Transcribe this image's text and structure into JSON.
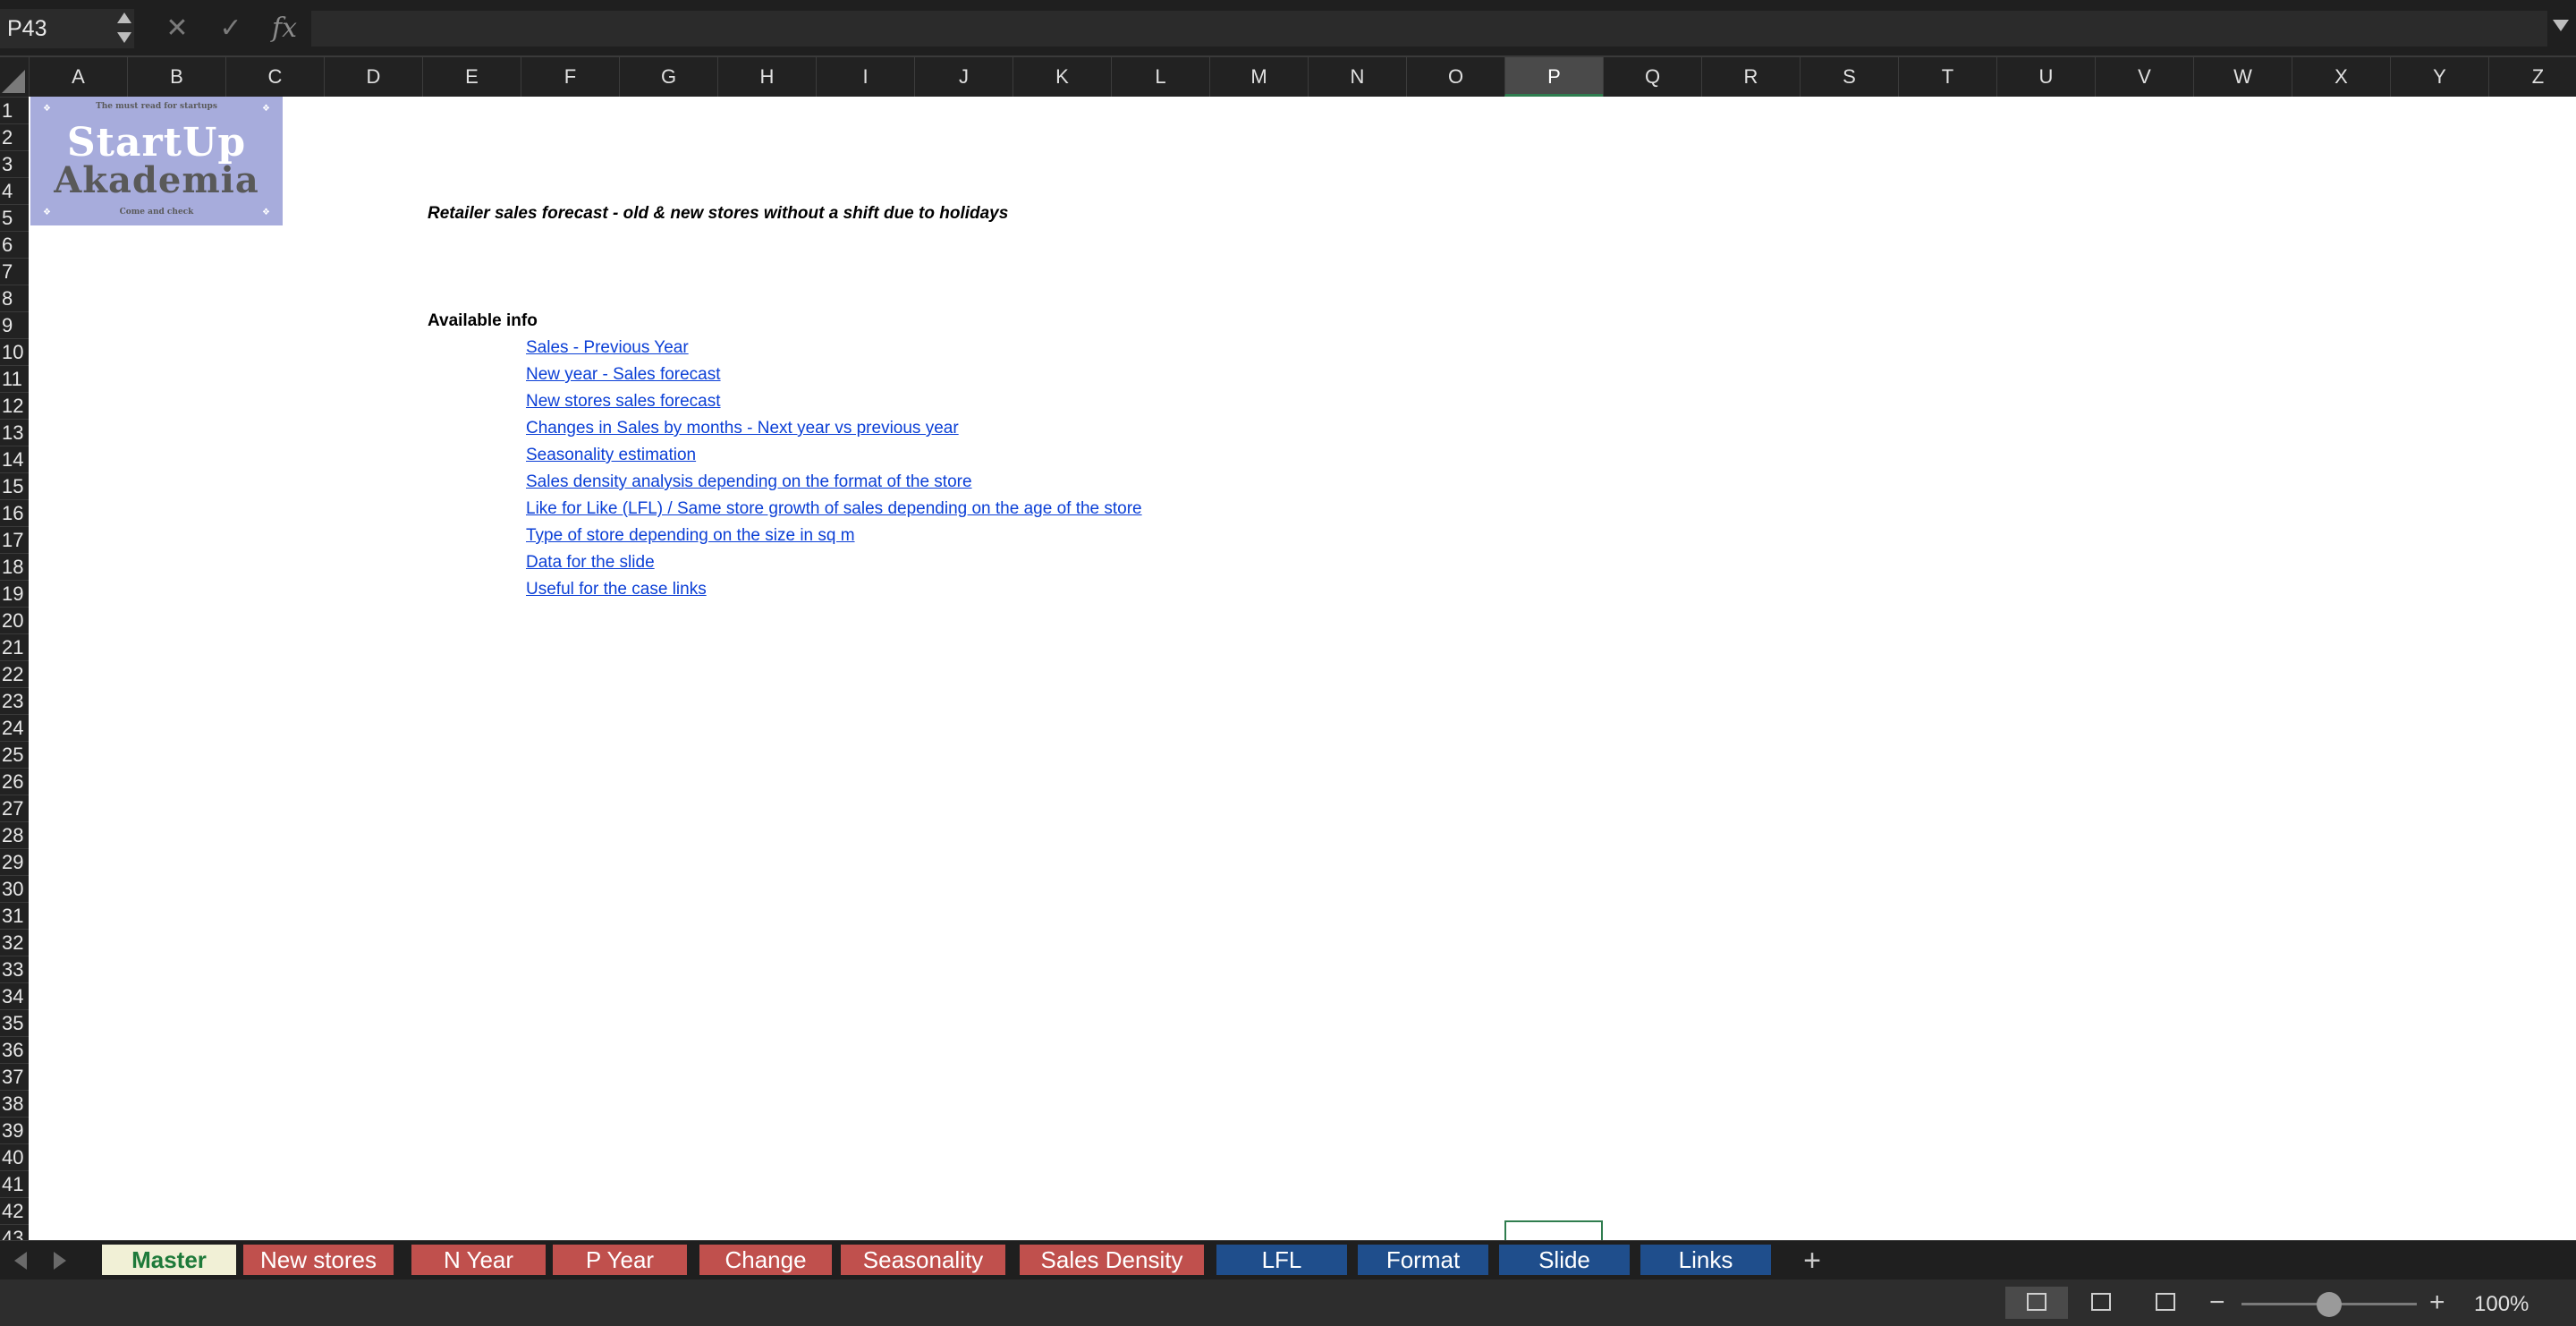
{
  "formula_bar": {
    "name_box": "P43",
    "cancel_icon": "close-icon",
    "confirm_icon": "check-icon",
    "fx_label": "fx",
    "formula_value": ""
  },
  "columns": [
    "A",
    "B",
    "C",
    "D",
    "E",
    "F",
    "G",
    "H",
    "I",
    "J",
    "K",
    "L",
    "M",
    "N",
    "O",
    "P",
    "Q",
    "R",
    "S",
    "T",
    "U",
    "V",
    "W",
    "X",
    "Y",
    "Z"
  ],
  "active_column": "P",
  "rows": [
    "1",
    "2",
    "3",
    "4",
    "5",
    "6",
    "7",
    "8",
    "9",
    "10",
    "11",
    "12",
    "13",
    "14",
    "15",
    "16",
    "17",
    "18",
    "19",
    "20",
    "21",
    "22",
    "23",
    "24",
    "25",
    "26",
    "27",
    "28",
    "29",
    "30",
    "31",
    "32",
    "33",
    "34",
    "35",
    "36",
    "37",
    "38",
    "39",
    "40",
    "41",
    "42",
    "43"
  ],
  "logo": {
    "tagline": "The must read for startups",
    "brand_line1": "StartUp",
    "brand_line2": "Akademia",
    "subline": "Come and  check"
  },
  "content": {
    "title": "Retailer sales forecast - old & new stores without a shift due to holidays",
    "available_label": "Available info",
    "links": [
      "Sales - Previous Year",
      "New year - Sales forecast",
      "New stores sales forecast",
      "Changes in Sales by months - Next year vs previous year",
      "Seasonality estimation",
      "Sales density analysis depending on the format of the store",
      "Like for Like (LFL) / Same store growth of sales depending on the age of the store",
      "Type of store depending on the size in sq m",
      "Data for the slide",
      "Useful for the case links"
    ]
  },
  "sheet_tabs": [
    {
      "label": "Master",
      "color": "active"
    },
    {
      "label": "New stores",
      "color": "red"
    },
    {
      "label": "N Year",
      "color": "red"
    },
    {
      "label": "P Year",
      "color": "red"
    },
    {
      "label": "Change",
      "color": "red"
    },
    {
      "label": "Seasonality",
      "color": "red"
    },
    {
      "label": "Sales Density",
      "color": "red"
    },
    {
      "label": "LFL",
      "color": "blue"
    },
    {
      "label": "Format",
      "color": "blue"
    },
    {
      "label": "Slide",
      "color": "blue"
    },
    {
      "label": "Links",
      "color": "blue"
    }
  ],
  "add_sheet_label": "+",
  "status_bar": {
    "view_modes": [
      "normal-view-icon",
      "page-layout-icon",
      "page-break-icon"
    ],
    "zoom_minus": "−",
    "zoom_plus": "+",
    "zoom_level": "100%",
    "zoom_percent": 100
  },
  "colors": {
    "tab_red": "#c0504d",
    "tab_blue": "#1f4e8c",
    "tab_active_bg": "#f1f0d6",
    "tab_active_text": "#1e7a3a",
    "link": "#0b3fd6",
    "logo_bg": "#a7acdc"
  }
}
